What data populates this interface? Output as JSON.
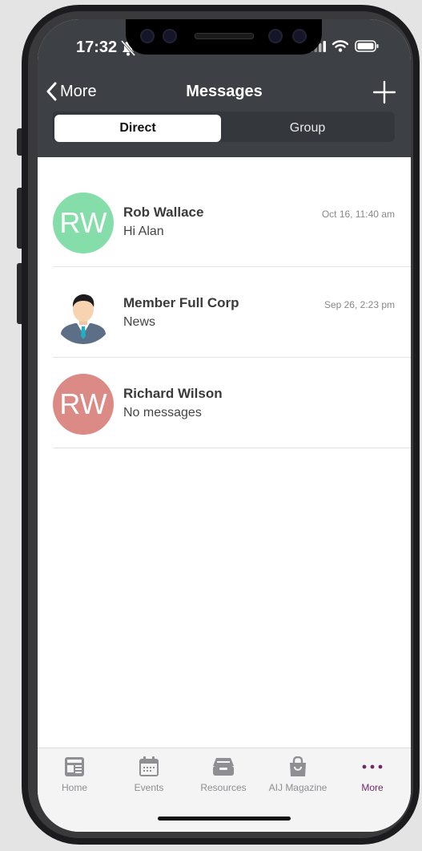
{
  "status": {
    "time": "17:32"
  },
  "nav": {
    "back_label": "More",
    "title": "Messages"
  },
  "segments": {
    "direct": "Direct",
    "group": "Group"
  },
  "conversations": [
    {
      "initials": "RW",
      "name": "Rob Wallace",
      "snippet": "Hi Alan",
      "time": "Oct 16, 11:40 am",
      "avatar_color": "#85deaa"
    },
    {
      "initials": "",
      "name": "Member Full Corp",
      "snippet": "News",
      "time": "Sep 26, 2:23 pm",
      "avatar_color": "#ffffff"
    },
    {
      "initials": "RW",
      "name": "Richard Wilson",
      "snippet": "No messages",
      "time": "",
      "avatar_color": "#db8a86"
    }
  ],
  "tabs": [
    {
      "label": "Home",
      "icon": "newspaper-icon"
    },
    {
      "label": "Events",
      "icon": "calendar-icon"
    },
    {
      "label": "Resources",
      "icon": "inbox-tray-icon"
    },
    {
      "label": "AIJ Magazine",
      "icon": "shopping-bag-icon"
    },
    {
      "label": "More",
      "icon": "ellipsis-icon",
      "active": true
    }
  ],
  "colors": {
    "header_bg": "#3d4045",
    "accent": "#6d2a66"
  }
}
